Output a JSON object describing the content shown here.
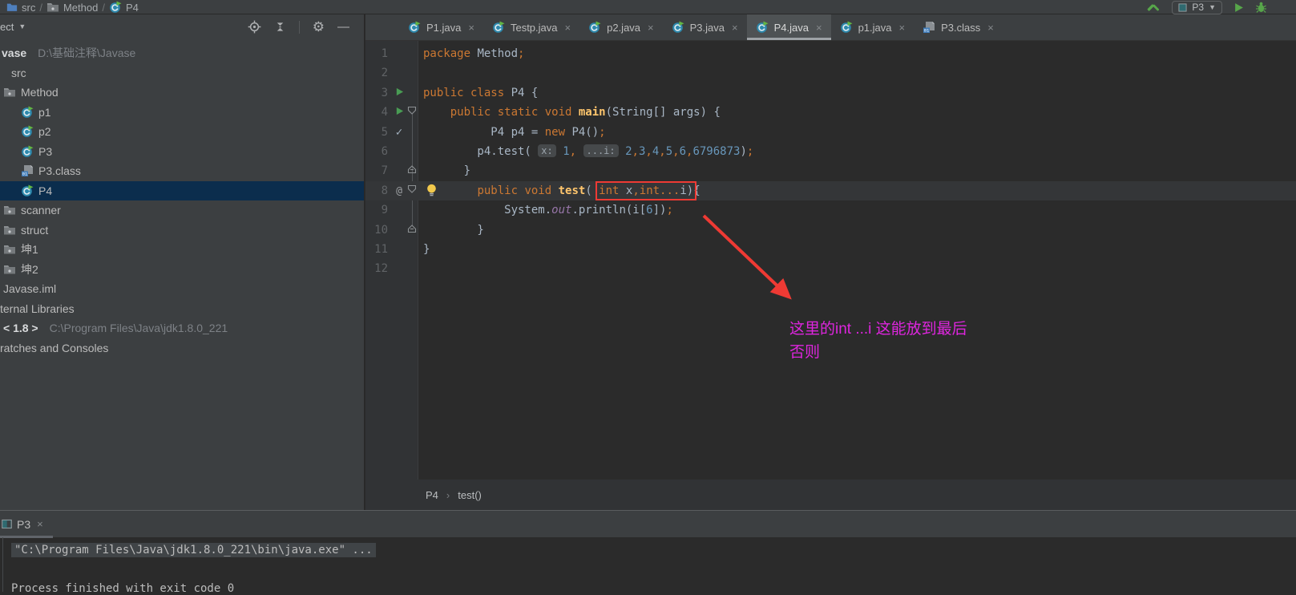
{
  "navbar": {
    "breadcrumbs": [
      {
        "icon": "folder-blue",
        "label": "src"
      },
      {
        "icon": "package",
        "label": "Method"
      },
      {
        "icon": "class",
        "label": "P4"
      }
    ],
    "run_config": "P3"
  },
  "project_panel": {
    "title": "ect",
    "tree": [
      {
        "label": "vase",
        "path": "D:\\基础注释\\Javase",
        "icon": "",
        "pad": 2,
        "bold": true
      },
      {
        "label": "src",
        "icon": "",
        "pad": 14
      },
      {
        "label": "Method",
        "icon": "package",
        "pad": 4
      },
      {
        "label": "p1",
        "icon": "class",
        "pad": 26
      },
      {
        "label": "p2",
        "icon": "class",
        "pad": 26
      },
      {
        "label": "P3",
        "icon": "class",
        "pad": 26
      },
      {
        "label": "P3.class",
        "icon": "class-file",
        "pad": 26
      },
      {
        "label": "P4",
        "icon": "class",
        "pad": 26,
        "selected": true
      },
      {
        "label": "scanner",
        "icon": "package",
        "pad": 4
      },
      {
        "label": "struct",
        "icon": "package",
        "pad": 4
      },
      {
        "label": "坤1",
        "icon": "package",
        "pad": 4
      },
      {
        "label": "坤2",
        "icon": "package",
        "pad": 4
      },
      {
        "label": "Javase.iml",
        "icon": "",
        "pad": 4
      },
      {
        "label": "ternal Libraries",
        "icon": "",
        "pad": 0
      },
      {
        "label": "< 1.8 >",
        "path": "C:\\Program Files\\Java\\jdk1.8.0_221",
        "icon": "",
        "pad": 4,
        "bold": true
      },
      {
        "label": "ratches and Consoles",
        "icon": "",
        "pad": 0
      }
    ]
  },
  "editor_tabs": [
    {
      "label": "P1.java",
      "icon": "class"
    },
    {
      "label": "Testp.java",
      "icon": "class"
    },
    {
      "label": "p2.java",
      "icon": "class"
    },
    {
      "label": "P3.java",
      "icon": "class"
    },
    {
      "label": "P4.java",
      "icon": "class",
      "active": true
    },
    {
      "label": "p1.java",
      "icon": "class"
    },
    {
      "label": "P3.class",
      "icon": "class-file"
    }
  ],
  "editor": {
    "lines": [
      {
        "num": "1",
        "tokens": [
          {
            "t": "package",
            "c": "kw"
          },
          {
            "t": " Method",
            "c": "d"
          },
          {
            "t": ";",
            "c": "kw"
          }
        ]
      },
      {
        "num": "2",
        "tokens": []
      },
      {
        "num": "3",
        "g": "run",
        "tokens": [
          {
            "t": "public class ",
            "c": "kw"
          },
          {
            "t": "P4 {",
            "c": "d"
          }
        ]
      },
      {
        "num": "4",
        "g": "run",
        "fold": "down",
        "tokens": [
          {
            "t": "    ",
            "c": "d"
          },
          {
            "t": "public static void ",
            "c": "kw"
          },
          {
            "t": "main",
            "c": "decl"
          },
          {
            "t": "(String[] args) {",
            "c": "d"
          }
        ]
      },
      {
        "num": "5",
        "g": "check",
        "tokens": [
          {
            "t": "          P4 p4 = ",
            "c": "d"
          },
          {
            "t": "new",
            "c": "kw"
          },
          {
            "t": " P4()",
            "c": "d"
          },
          {
            "t": ";",
            "c": "kw"
          }
        ]
      },
      {
        "num": "6",
        "tokens": [
          {
            "t": "        p4.test( ",
            "c": "d"
          },
          {
            "t": "x:",
            "c": "hint"
          },
          {
            "t": " ",
            "c": "d"
          },
          {
            "t": "1",
            "c": "num"
          },
          {
            "t": ",",
            "c": "kw"
          },
          {
            "t": " ",
            "c": "d"
          },
          {
            "t": "...i:",
            "c": "hint"
          },
          {
            "t": " ",
            "c": "d"
          },
          {
            "t": "2",
            "c": "num"
          },
          {
            "t": ",",
            "c": "kw"
          },
          {
            "t": "3",
            "c": "num"
          },
          {
            "t": ",",
            "c": "kw"
          },
          {
            "t": "4",
            "c": "num"
          },
          {
            "t": ",",
            "c": "kw"
          },
          {
            "t": "5",
            "c": "num"
          },
          {
            "t": ",",
            "c": "kw"
          },
          {
            "t": "6",
            "c": "num"
          },
          {
            "t": ",",
            "c": "kw"
          },
          {
            "t": "6796873",
            "c": "num"
          },
          {
            "t": ")",
            "c": "d"
          },
          {
            "t": ";",
            "c": "kw"
          }
        ]
      },
      {
        "num": "7",
        "fold": "up",
        "tokens": [
          {
            "t": "      }",
            "c": "d"
          }
        ]
      },
      {
        "num": "8",
        "g": "at",
        "fold": "down",
        "bulb": true,
        "current": true,
        "tokens": [
          {
            "t": "        ",
            "c": "d"
          },
          {
            "t": "public void ",
            "c": "kw"
          },
          {
            "t": "test",
            "c": "decl"
          },
          {
            "t": "( ",
            "c": "d"
          },
          {
            "t": "int",
            "c": "kw",
            "box": true
          },
          {
            "t": " x",
            "c": "d",
            "box": true
          },
          {
            "t": ",",
            "c": "kw",
            "box": true
          },
          {
            "t": "int...",
            "c": "kw",
            "box": true
          },
          {
            "t": "i",
            "c": "d",
            "box": true
          },
          {
            "t": ")",
            "c": "d",
            "box": true
          },
          {
            "t": "{",
            "c": "d"
          }
        ]
      },
      {
        "num": "9",
        "tokens": [
          {
            "t": "            System.",
            "c": "d"
          },
          {
            "t": "out",
            "c": "field"
          },
          {
            "t": ".println(i[",
            "c": "d"
          },
          {
            "t": "6",
            "c": "num"
          },
          {
            "t": "])",
            "c": "d"
          },
          {
            "t": ";",
            "c": "kw"
          }
        ]
      },
      {
        "num": "10",
        "fold": "up",
        "tokens": [
          {
            "t": "        }",
            "c": "d"
          }
        ]
      },
      {
        "num": "11",
        "tokens": [
          {
            "t": "}",
            "c": "d"
          }
        ]
      },
      {
        "num": "12",
        "tokens": []
      }
    ],
    "annotation": {
      "line1": "这里的int ...i 这能放到最后",
      "line2": "否则"
    },
    "breadcrumb": {
      "item1": "P4",
      "item2": "test()"
    }
  },
  "console": {
    "tab_label": "P3",
    "line1": "\"C:\\Program Files\\Java\\jdk1.8.0_221\\bin\\java.exe\" ...",
    "line2": "Process finished with exit code 0"
  },
  "colors": {
    "keyword": "#cc7832",
    "plain": "#a9b7c6",
    "number": "#6897bb",
    "method_decl": "#ffc66d",
    "field": "#9876aa",
    "annotation_magenta": "#df25df",
    "arrow_red": "#ee3a34",
    "selection_blue": "#0b2d4d",
    "panel_bg": "#3c3f41",
    "editor_bg": "#2b2b2b"
  }
}
